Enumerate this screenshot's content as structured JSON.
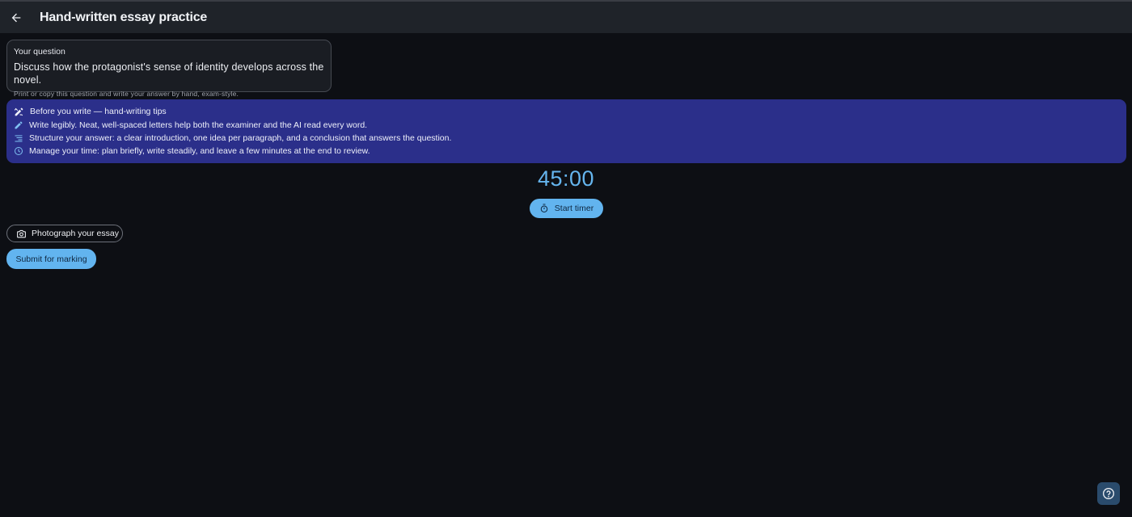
{
  "appbar": {
    "title": "Hand-written essay practice",
    "back_icon": "arrow-left-icon"
  },
  "question": {
    "label": "Your question",
    "text": "Discuss how the protagonist's sense of identity develops across the novel.",
    "hint": "Print or copy this question and write your answer by hand, exam-style."
  },
  "tips": {
    "header": "Before you write — hand-writing tips",
    "items": [
      {
        "icon": "pencil-icon",
        "text": "Write legibly. Neat, well-spaced letters help both the examiner and the AI read every word."
      },
      {
        "icon": "text-lines-icon",
        "text": "Structure your answer: a clear introduction, one idea per paragraph, and a conclusion that answers the question."
      },
      {
        "icon": "clock-icon",
        "text": "Manage your time: plan briefly, write steadily, and leave a few minutes at the end to review."
      }
    ]
  },
  "timer": {
    "display": "45:00",
    "start_label": "Start timer"
  },
  "actions": {
    "photograph_label": "Photograph your essay",
    "submit_label": "Submit for marking"
  },
  "colors": {
    "background": "#0d0f14",
    "appbar": "#1f2329",
    "tips_panel": "#2b2f8a",
    "accent": "#62b4ef",
    "help_button": "#2a4b6c"
  }
}
